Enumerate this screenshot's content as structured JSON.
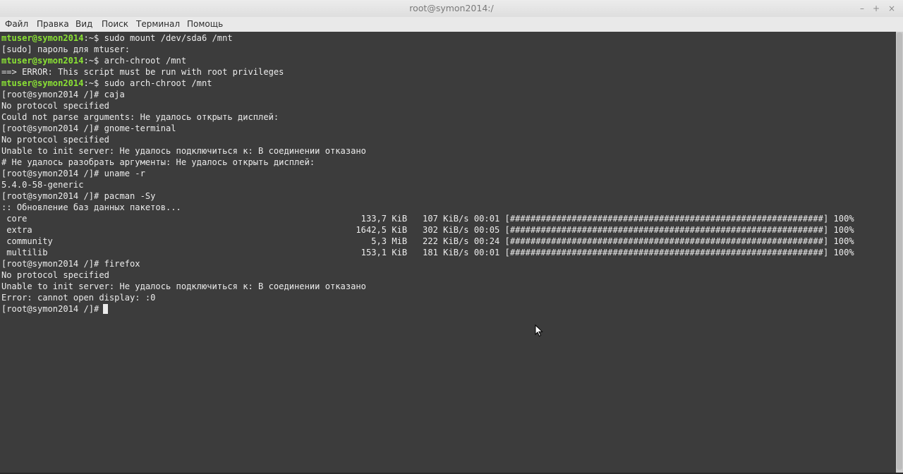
{
  "window": {
    "title": "root@symon2014:/",
    "controls": {
      "minimize": "–",
      "maximize": "+",
      "close": "×"
    }
  },
  "menubar": [
    "Файл",
    "Правка",
    "Вид",
    "Поиск",
    "Терминал",
    "Помощь"
  ],
  "terminal": {
    "colors": {
      "background": "#3c3c3c",
      "foreground": "#ececec",
      "user_prompt": "#8ae234"
    },
    "lines": [
      {
        "user": "mtuser@symon2014",
        "rest": ":~$ sudo mount /dev/sda6 /mnt"
      },
      {
        "text": "[sudo] пароль для mtuser:"
      },
      {
        "user": "mtuser@symon2014",
        "rest": ":~$ arch-chroot /mnt"
      },
      {
        "text": "==> ERROR: This script must be run with root privileges"
      },
      {
        "user": "mtuser@symon2014",
        "rest": ":~$ sudo arch-chroot /mnt"
      },
      {
        "text": "[root@symon2014 /]# caja"
      },
      {
        "text": "No protocol specified"
      },
      {
        "text": "Could not parse arguments: Не удалось открыть дисплей:"
      },
      {
        "text": "[root@symon2014 /]# gnome-terminal"
      },
      {
        "text": "No protocol specified"
      },
      {
        "text": "Unable to init server: Не удалось подключиться к: В соединении отказано"
      },
      {
        "text": "# Не удалось разобрать аргументы: Не удалось открыть дисплей:"
      },
      {
        "text": "[root@symon2014 /]# uname -r"
      },
      {
        "text": "5.4.0-58-generic"
      },
      {
        "text": "[root@symon2014 /]# pacman -Sy"
      },
      {
        "text": ":: Обновление баз данных пакетов..."
      },
      {
        "text": " core                                                                 133,7 KiB   107 KiB/s 00:01 [#############################################################] 100%"
      },
      {
        "text": " extra                                                               1642,5 KiB   302 KiB/s 00:05 [#############################################################] 100%"
      },
      {
        "text": " community                                                              5,3 MiB   222 KiB/s 00:24 [#############################################################] 100%"
      },
      {
        "text": " multilib                                                             153,1 KiB   181 KiB/s 00:01 [#############################################################] 100%"
      },
      {
        "text": "[root@symon2014 /]# firefox"
      },
      {
        "text": "No protocol specified"
      },
      {
        "text": "Unable to init server: Не удалось подключиться к: В соединении отказано"
      },
      {
        "text": "Error: cannot open display: :0"
      },
      {
        "text": "[root@symon2014 /]# "
      }
    ]
  }
}
